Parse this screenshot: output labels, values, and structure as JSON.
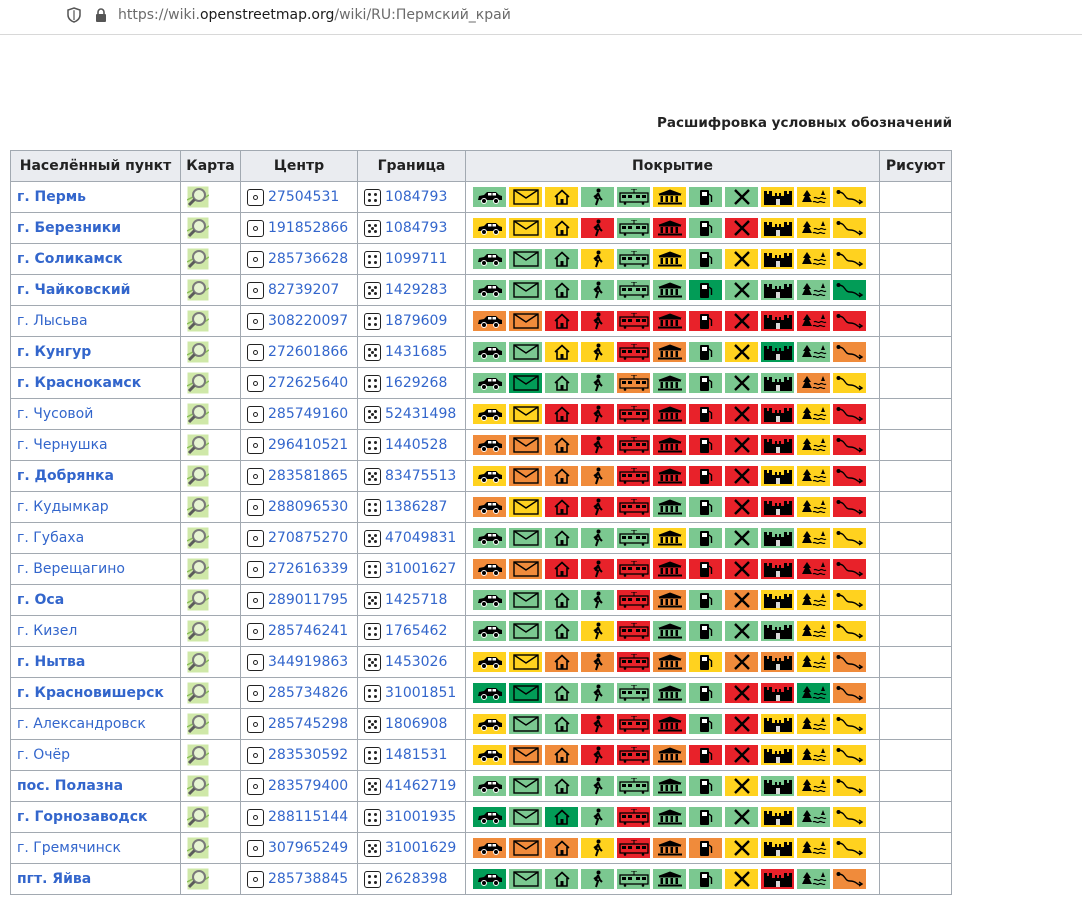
{
  "browser": {
    "url_prefix": "https://wiki.",
    "url_domain": "openstreetmap.org",
    "url_path": "/wiki/RU:Пермский_край"
  },
  "legend_link": "Расшифровка условных обозначений",
  "table": {
    "headers": [
      "Населённый пункт",
      "Карта",
      "Центр",
      "Граница",
      "Покрытие",
      "Рисуют"
    ],
    "coverage_icons": [
      "car-icon",
      "mail-icon",
      "house-icon",
      "pedestrian-icon",
      "tram-icon",
      "museum-icon",
      "fuel-icon",
      "tools-icon",
      "castle-icon",
      "nature-icon",
      "route-icon"
    ],
    "colors": {
      "g": "#7bc890",
      "y": "#ffd21f",
      "o": "#f08b3b",
      "r": "#e8222a",
      "d": "#029c57"
    },
    "rows": [
      {
        "name": "г. Пермь",
        "bold": true,
        "center": "27504531",
        "border": "1084793",
        "cov": "gyyggyggyyy"
      },
      {
        "name": "г. Березники",
        "bold": true,
        "center": "191852866",
        "border": "1084793",
        "cov": "yyyrgrgryyy"
      },
      {
        "name": "г. Соликамск",
        "bold": true,
        "center": "285736628",
        "border": "1099711",
        "cov": "gggygygyyyy"
      },
      {
        "name": "г. Чайковский",
        "bold": true,
        "center": "82739207",
        "border": "1429283",
        "cov": "ggggggdgggd"
      },
      {
        "name": "г. Лысьва",
        "bold": false,
        "center": "308220097",
        "border": "1879609",
        "cov": "oorrrrrrrrr"
      },
      {
        "name": "г. Кунгур",
        "bold": true,
        "center": "272601866",
        "border": "1431685",
        "cov": "ggyyrogydgo"
      },
      {
        "name": "г. Краснокамск",
        "bold": true,
        "center": "272625640",
        "border": "1629268",
        "cov": "gdggoggggoy"
      },
      {
        "name": "г. Чусовой",
        "bold": false,
        "center": "285749160",
        "border": "52431498",
        "cov": "yyrrrrrrryr"
      },
      {
        "name": "г. Чернушка",
        "bold": false,
        "center": "296410521",
        "border": "1440528",
        "cov": "ooorrrrrryr"
      },
      {
        "name": "г. Добрянка",
        "bold": true,
        "center": "283581865",
        "border": "83475513",
        "cov": "yooorrrryyr"
      },
      {
        "name": "г. Кудымкар",
        "bold": false,
        "center": "288096530",
        "border": "1386287",
        "cov": "oyrrrggrryr"
      },
      {
        "name": "г. Губаха",
        "bold": false,
        "center": "270875270",
        "border": "47049831",
        "cov": "gggggygggyy"
      },
      {
        "name": "г. Верещагино",
        "bold": false,
        "center": "272616339",
        "border": "31001627",
        "cov": "oorrrrrrrrr"
      },
      {
        "name": "г. Оса",
        "bold": true,
        "center": "289011795",
        "border": "1425718",
        "cov": "ggggrogoyyy"
      },
      {
        "name": "г. Кизел",
        "bold": false,
        "center": "285746241",
        "border": "1765462",
        "cov": "gggyrggggyy"
      },
      {
        "name": "г. Нытва",
        "bold": true,
        "center": "344919863",
        "border": "1453026",
        "cov": "yyooroyooyo"
      },
      {
        "name": "г. Красновишерск",
        "bold": true,
        "center": "285734826",
        "border": "31001851",
        "cov": "ddgggggrrdo"
      },
      {
        "name": "г. Александровск",
        "bold": false,
        "center": "285745298",
        "border": "1806908",
        "cov": "yggrrrgryyy"
      },
      {
        "name": "г. Очёр",
        "bold": false,
        "center": "283530592",
        "border": "1481531",
        "cov": "yoorrorryyy"
      },
      {
        "name": "пос. Полазна",
        "bold": true,
        "center": "283579400",
        "border": "41462719",
        "cov": "gggggggygyy"
      },
      {
        "name": "г. Горнозаводск",
        "bold": true,
        "center": "288115144",
        "border": "31001935",
        "cov": "dgdgrgggygy"
      },
      {
        "name": "г. Гремячинск",
        "bold": false,
        "center": "307965249",
        "border": "31001629",
        "cov": "oooyrooyyyy"
      },
      {
        "name": "пгт. Яйва",
        "bold": true,
        "center": "285738845",
        "border": "2628398",
        "cov": "dggggggyrgo"
      }
    ]
  }
}
